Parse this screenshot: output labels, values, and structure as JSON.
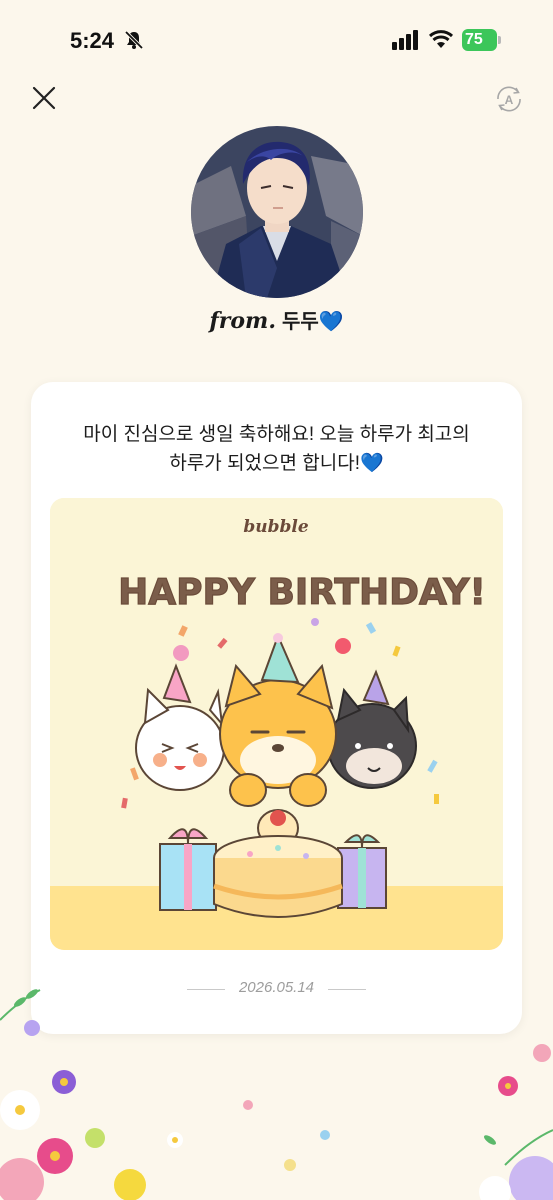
{
  "status_bar": {
    "time": "5:24",
    "battery": "75",
    "icons": [
      "bell-slash-icon",
      "cellular-signal-icon",
      "wifi-icon",
      "battery-icon"
    ]
  },
  "top_bar": {
    "close_icon": "close-icon",
    "translate_icon": "auto-translate-icon",
    "translate_glyph": "A"
  },
  "sender": {
    "from_label": "from.",
    "name": "두두💙"
  },
  "message": {
    "line1": "마이 진심으로 생일 축하해요! 오늘 하루가 최고의",
    "line2": "하루가 되었으면 합니다!💙"
  },
  "card_image": {
    "brand": "bubble",
    "headline": "HAPPY BIRTHDAY!"
  },
  "date": "2026.05.14",
  "colors": {
    "background": "#fcf7ec",
    "card": "#ffffff",
    "card_image_bg": "#fbf5d6",
    "headline": "#7b5d4a",
    "battery": "#3cc65a"
  }
}
